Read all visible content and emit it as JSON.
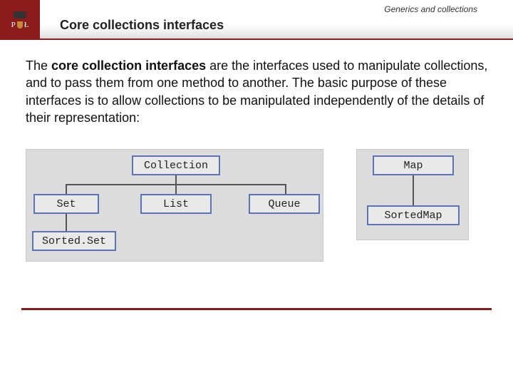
{
  "header": {
    "category": "Generics and collections",
    "title": "Core collections interfaces",
    "logo": {
      "left_letter": "P",
      "right_letter": "Ł"
    }
  },
  "body": {
    "lead": "The ",
    "strong": "core collection interfaces",
    "rest": " are the interfaces used to manipulate collections, and to pass them from one method to another. The basic purpose of these interfaces is to allow collections to be manipulated independently of the details of their representation:"
  },
  "diagram": {
    "left": {
      "root": "Collection",
      "children": [
        "Set",
        "List",
        "Queue"
      ],
      "grandchild": "Sorted.Set"
    },
    "right": {
      "root": "Map",
      "child": "SortedMap"
    }
  }
}
